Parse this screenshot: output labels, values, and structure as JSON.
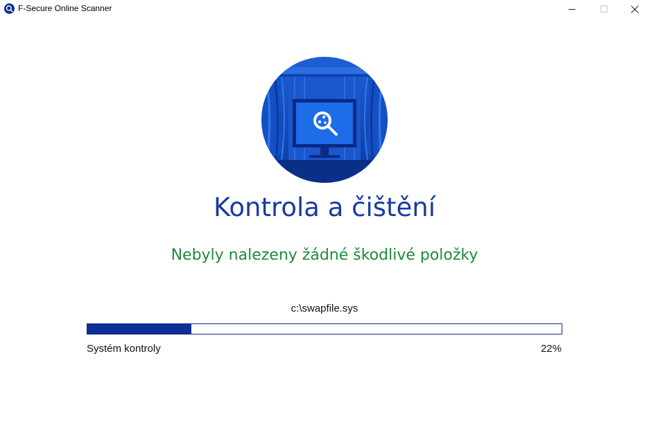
{
  "window": {
    "title": "F-Secure Online Scanner",
    "app_icon": "fsecure-scanner-icon",
    "controls": {
      "minimize": "minimize-icon",
      "maximize": "maximize-icon",
      "close": "close-icon"
    }
  },
  "hero": {
    "icon": "monitor-magnifier-icon"
  },
  "main": {
    "heading": "Kontrola a čištění",
    "status_text": "Nebyly nalezeny žádné škodlivé položky",
    "current_file": "c:\\swapfile.sys",
    "progress": {
      "label": "Systém kontroly",
      "percent_text": "22%",
      "value": 0.22
    }
  },
  "colors": {
    "accent": "#0c2f96",
    "heading": "#1a3aa2",
    "status_ok": "#1f8a3a"
  }
}
